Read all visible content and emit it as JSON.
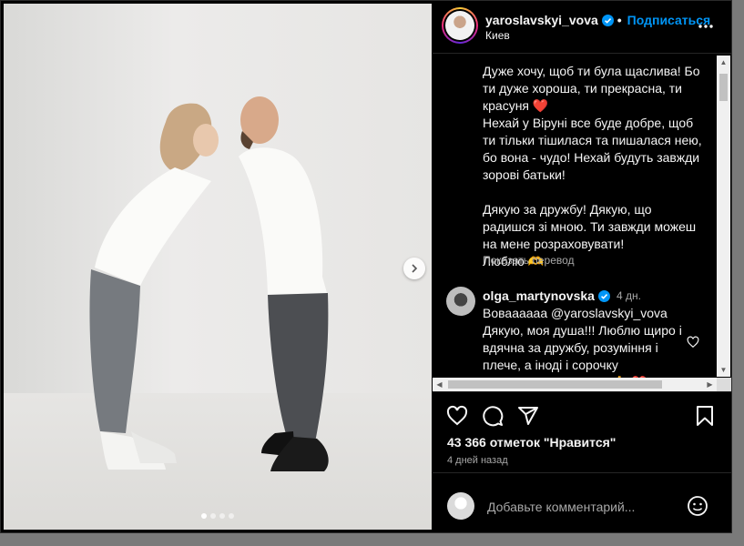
{
  "header": {
    "username": "yaroslavskyi_vova",
    "follow_label": "Подписаться",
    "location": "Киев",
    "verified_icon": "verified-badge-icon",
    "more_icon": "more-options-icon"
  },
  "caption": {
    "text": "Дуже хочу, щоб ти була щаслива! Бо ти дуже хороша, ти прекрасна, ти красуня ❤️\nНехай у Віруні все буде добре, щоб ти тільки тішилася та пишалася нею, бо вона - чудо! Нехай будуть завжди зорові батьки!\n\nДякую за дружбу! Дякую, що радишся зі мною. Ти завжди можеш на мене розраховувати!\nЛюблю 🫶",
    "translate_label": "Показать перевод"
  },
  "comment": {
    "username": "olga_martynovska",
    "time": "4 дн.",
    "text": "Вовааaaaa @yaroslavskyi_vova Дякую, моя душа!!! Люблю щиро і вдячна за дружбу, розуміння і плече, а іноді і сорочку поплакатися!!! Дякую 🙏 ❤️"
  },
  "post": {
    "likes": "43 366 отметок \"Нравится\"",
    "time_ago": "4 дней назад"
  },
  "comment_input": {
    "placeholder": "Добавьте комментарий..."
  },
  "photo": {
    "alt": "photo-of-couple-kissing",
    "slide_count": 4,
    "active_slide": 0
  },
  "colors": {
    "accent": "#0095f6",
    "background": "#000000",
    "text": "#f5f5f5",
    "muted": "#a8a8a8"
  }
}
